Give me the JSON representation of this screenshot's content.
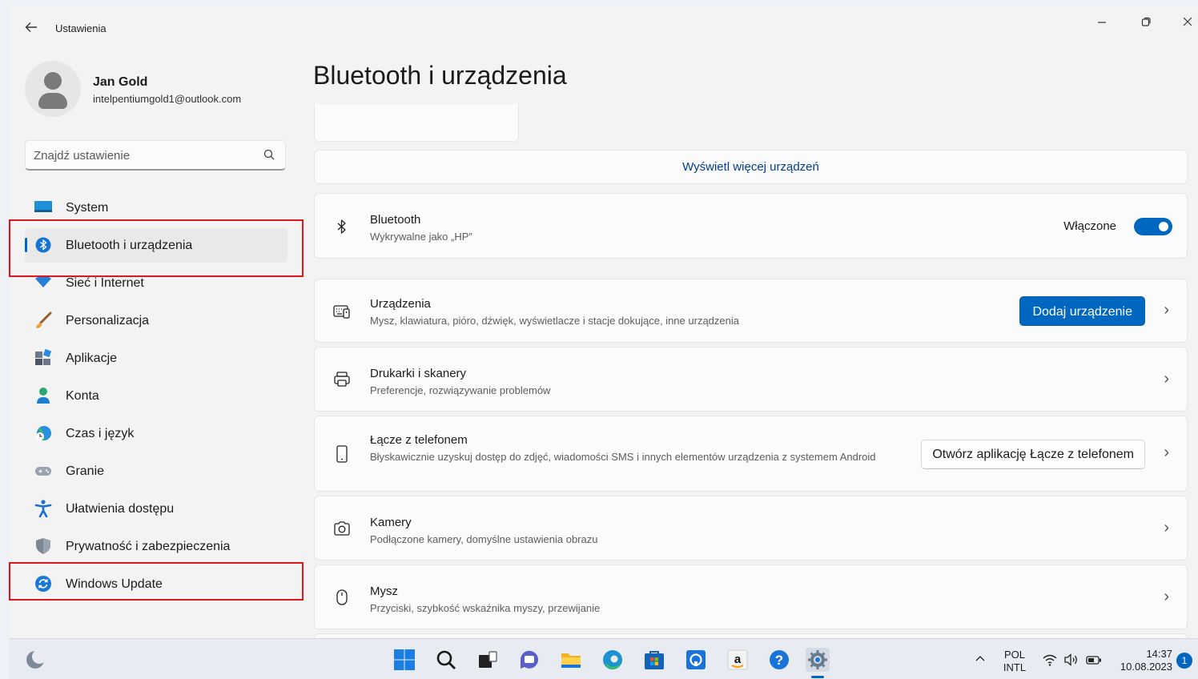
{
  "titlebar": {
    "back_icon": "arrow-left-icon",
    "title": "Ustawienia"
  },
  "user": {
    "name": "Jan Gold",
    "email": "intelpentiumgold1@outlook.com"
  },
  "search": {
    "placeholder": "Znajdź ustawienie",
    "icon": "search-icon"
  },
  "nav": [
    {
      "label": "System",
      "icon": "system-display-icon",
      "selected": false
    },
    {
      "label": "Bluetooth i urządzenia",
      "icon": "bluetooth-icon",
      "selected": true
    },
    {
      "label": "Sieć i Internet",
      "icon": "wifi-icon",
      "selected": false
    },
    {
      "label": "Personalizacja",
      "icon": "brush-icon",
      "selected": false
    },
    {
      "label": "Aplikacje",
      "icon": "apps-icon",
      "selected": false
    },
    {
      "label": "Konta",
      "icon": "account-icon",
      "selected": false
    },
    {
      "label": "Czas i język",
      "icon": "globe-clock-icon",
      "selected": false
    },
    {
      "label": "Granie",
      "icon": "gamepad-icon",
      "selected": false
    },
    {
      "label": "Ułatwienia dostępu",
      "icon": "accessibility-icon",
      "selected": false
    },
    {
      "label": "Prywatność i zabezpieczenia",
      "icon": "shield-icon",
      "selected": false
    },
    {
      "label": "Windows Update",
      "icon": "windows-update-icon",
      "selected": false
    }
  ],
  "main": {
    "title": "Bluetooth i urządzenia",
    "more_devices": "Wyświetl więcej urządzeń",
    "bluetooth": {
      "title": "Bluetooth",
      "subtitle": "Wykrywalne jako „HP”",
      "state_label": "Włączone",
      "on": true
    },
    "devices": {
      "title": "Urządzenia",
      "subtitle": "Mysz, klawiatura, pióro, dźwięk, wyświetlacze i stacje dokujące, inne urządzenia",
      "button": "Dodaj urządzenie"
    },
    "printers": {
      "title": "Drukarki i skanery",
      "subtitle": "Preferencje, rozwiązywanie problemów"
    },
    "phone": {
      "title": "Łącze z telefonem",
      "subtitle": "Błyskawicznie uzyskuj dostęp do zdjęć, wiadomości SMS i innych elementów urządzenia z systemem Android",
      "button": "Otwórz aplikację Łącze z telefonem"
    },
    "cameras": {
      "title": "Kamery",
      "subtitle": "Podłączone kamery, domyślne ustawienia obrazu"
    },
    "mouse": {
      "title": "Mysz",
      "subtitle": "Przyciski, szybkość wskaźnika myszy, przewijanie"
    }
  },
  "taskbar": {
    "lang_top": "POL",
    "lang_bottom": "INTL",
    "time": "14:37",
    "date": "10.08.2023",
    "notifications": "1"
  },
  "colors": {
    "accent": "#0067c0",
    "highlight_box": "#e0161e"
  }
}
